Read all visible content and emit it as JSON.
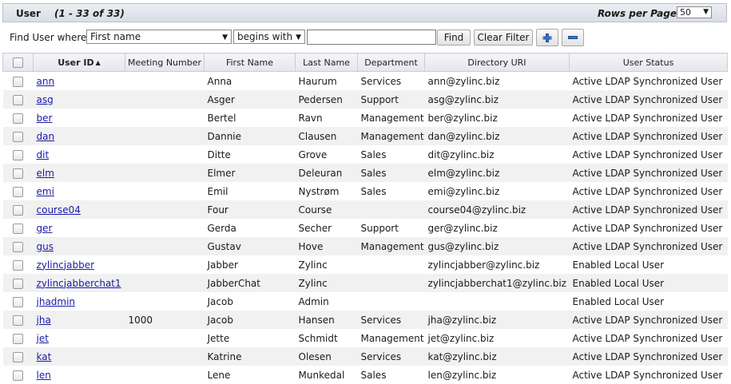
{
  "header": {
    "title": "User",
    "count": "(1 - 33 of 33)",
    "rows_per_page_label": "Rows per Page",
    "rows_per_page_value": "50"
  },
  "filter": {
    "label": "Find User where",
    "field": "First name",
    "operator": "begins with",
    "value": "",
    "find_label": "Find",
    "clear_label": "Clear Filter"
  },
  "columns": [
    "User ID",
    "Meeting Number",
    "First Name",
    "Last Name",
    "Department",
    "Directory URI",
    "User Status"
  ],
  "rows": [
    {
      "id": "ann",
      "meeting": "",
      "first": "Anna",
      "last": "Haurum",
      "dept": "Services",
      "uri": "ann@zylinc.biz",
      "status": "Active LDAP Synchronized User"
    },
    {
      "id": "asg",
      "meeting": "",
      "first": "Asger",
      "last": "Pedersen",
      "dept": "Support",
      "uri": "asg@zylinc.biz",
      "status": "Active LDAP Synchronized User"
    },
    {
      "id": "ber",
      "meeting": "",
      "first": "Bertel",
      "last": "Ravn",
      "dept": "Management",
      "uri": "ber@zylinc.biz",
      "status": "Active LDAP Synchronized User"
    },
    {
      "id": "dan",
      "meeting": "",
      "first": "Dannie",
      "last": "Clausen",
      "dept": "Management",
      "uri": "dan@zylinc.biz",
      "status": "Active LDAP Synchronized User"
    },
    {
      "id": "dit",
      "meeting": "",
      "first": "Ditte",
      "last": "Grove",
      "dept": "Sales",
      "uri": "dit@zylinc.biz",
      "status": "Active LDAP Synchronized User"
    },
    {
      "id": "elm",
      "meeting": "",
      "first": "Elmer",
      "last": "Deleuran",
      "dept": "Sales",
      "uri": "elm@zylinc.biz",
      "status": "Active LDAP Synchronized User"
    },
    {
      "id": "emi",
      "meeting": "",
      "first": "Emil",
      "last": "Nystrøm",
      "dept": "Sales",
      "uri": "emi@zylinc.biz",
      "status": "Active LDAP Synchronized User"
    },
    {
      "id": "course04",
      "meeting": "",
      "first": "Four",
      "last": "Course",
      "dept": "",
      "uri": "course04@zylinc.biz",
      "status": "Active LDAP Synchronized User"
    },
    {
      "id": "ger",
      "meeting": "",
      "first": "Gerda",
      "last": "Secher",
      "dept": "Support",
      "uri": "ger@zylinc.biz",
      "status": "Active LDAP Synchronized User"
    },
    {
      "id": "gus",
      "meeting": "",
      "first": "Gustav",
      "last": "Hove",
      "dept": "Management",
      "uri": "gus@zylinc.biz",
      "status": "Active LDAP Synchronized User"
    },
    {
      "id": "zylincjabber",
      "meeting": "",
      "first": "Jabber",
      "last": "Zylinc",
      "dept": "",
      "uri": "zylincjabber@zylinc.biz",
      "status": "Enabled Local User"
    },
    {
      "id": "zylincjabberchat1",
      "meeting": "",
      "first": "JabberChat",
      "last": "Zylinc",
      "dept": "",
      "uri": "zylincjabberchat1@zylinc.biz",
      "status": "Enabled Local User"
    },
    {
      "id": "jhadmin",
      "meeting": "",
      "first": "Jacob",
      "last": "Admin",
      "dept": "",
      "uri": "",
      "status": "Enabled Local User"
    },
    {
      "id": "jha",
      "meeting": "1000",
      "first": "Jacob",
      "last": "Hansen",
      "dept": "Services",
      "uri": "jha@zylinc.biz",
      "status": "Active LDAP Synchronized User"
    },
    {
      "id": "jet",
      "meeting": "",
      "first": "Jette",
      "last": "Schmidt",
      "dept": "Management",
      "uri": "jet@zylinc.biz",
      "status": "Active LDAP Synchronized User"
    },
    {
      "id": "kat",
      "meeting": "",
      "first": "Katrine",
      "last": "Olesen",
      "dept": "Services",
      "uri": "kat@zylinc.biz",
      "status": "Active LDAP Synchronized User"
    },
    {
      "id": "len",
      "meeting": "",
      "first": "Lene",
      "last": "Munkedal",
      "dept": "Sales",
      "uri": "len@zylinc.biz",
      "status": "Active LDAP Synchronized User"
    }
  ]
}
